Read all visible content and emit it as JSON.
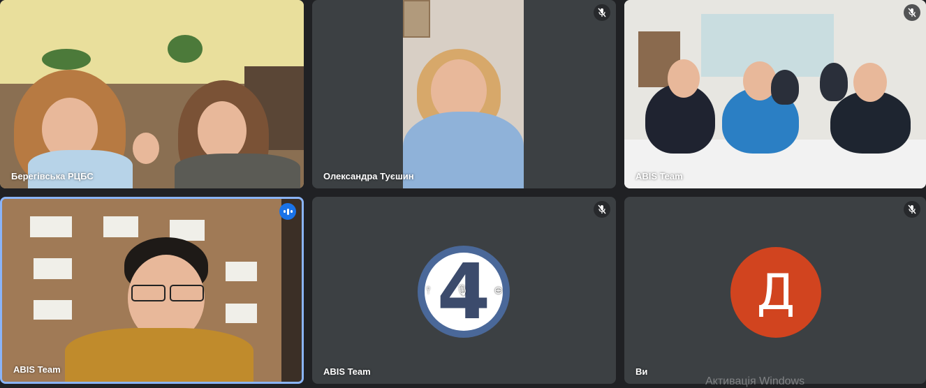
{
  "tiles": [
    {
      "name": "Берегівська РЦБС",
      "mic": "mic-off"
    },
    {
      "name": "Олександра Туєшин",
      "mic": "mic-off"
    },
    {
      "name": "ABIS Team",
      "mic": "mic-off"
    },
    {
      "name": "ABIS Team",
      "mic": "speaking"
    },
    {
      "name": "ABIS Team",
      "mic": "mic-off",
      "avatar_text": "4"
    },
    {
      "name": "Ви",
      "mic": "mic-off",
      "avatar_text": "Д"
    }
  ],
  "hover_controls": {
    "pin": "⫯",
    "mute": "🎙",
    "remove": "⊖"
  },
  "colors": {
    "background": "#202124",
    "tile": "#3c4043",
    "active_border": "#8ab4f8",
    "avatar_d": "#d1441f",
    "logo": "#4a6899"
  },
  "watermark": "Активація Windows"
}
